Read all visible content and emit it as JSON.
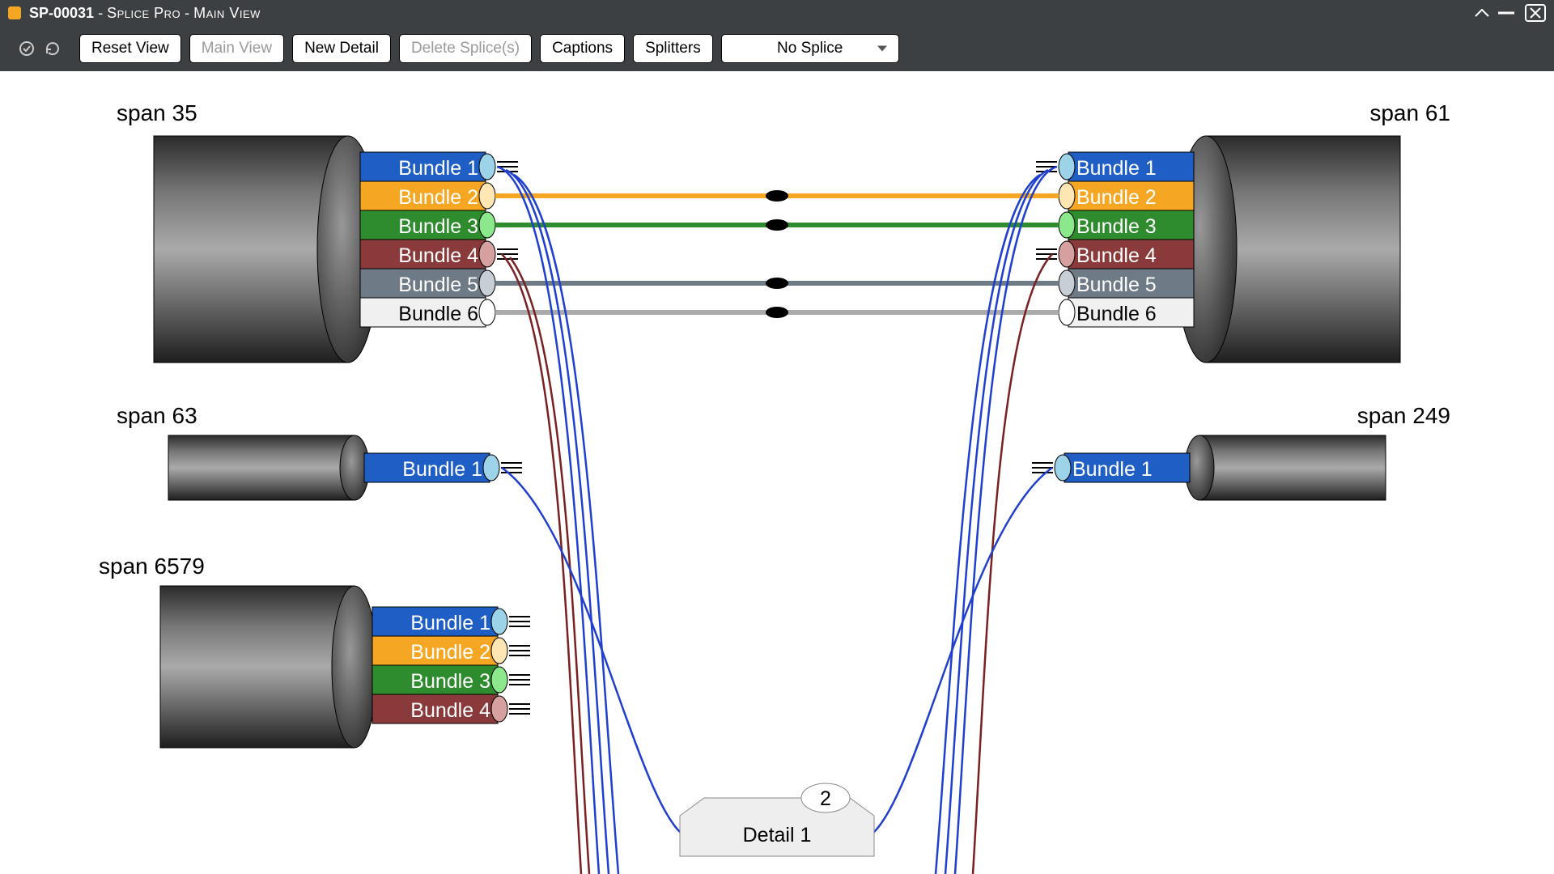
{
  "title": {
    "id": "SP-00031",
    "app": "Splice Pro",
    "view": "Main View"
  },
  "toolbar": {
    "reset": "Reset View",
    "main_view": "Main View",
    "new_detail": "New Detail",
    "delete_splice": "Delete Splice(s)",
    "captions": "Captions",
    "splitters": "Splitters",
    "splice_mode": "No Splice"
  },
  "spans": {
    "s35": "span 35",
    "s61": "span 61",
    "s63": "span 63",
    "s249": "span 249",
    "s6579": "span 6579"
  },
  "bundles": {
    "b1": "Bundle 1",
    "b2": "Bundle 2",
    "b3": "Bundle 3",
    "b4": "Bundle 4",
    "b5": "Bundle 5",
    "b6": "Bundle 6"
  },
  "detail": {
    "name": "Detail 1",
    "count": "2"
  },
  "colors": {
    "blue": "#1f5fc5",
    "orange": "#f5a623",
    "green": "#2e8b2e",
    "maroon": "#7a2f2f",
    "slate": "#6e7a86",
    "white": "#e8e8e8"
  }
}
